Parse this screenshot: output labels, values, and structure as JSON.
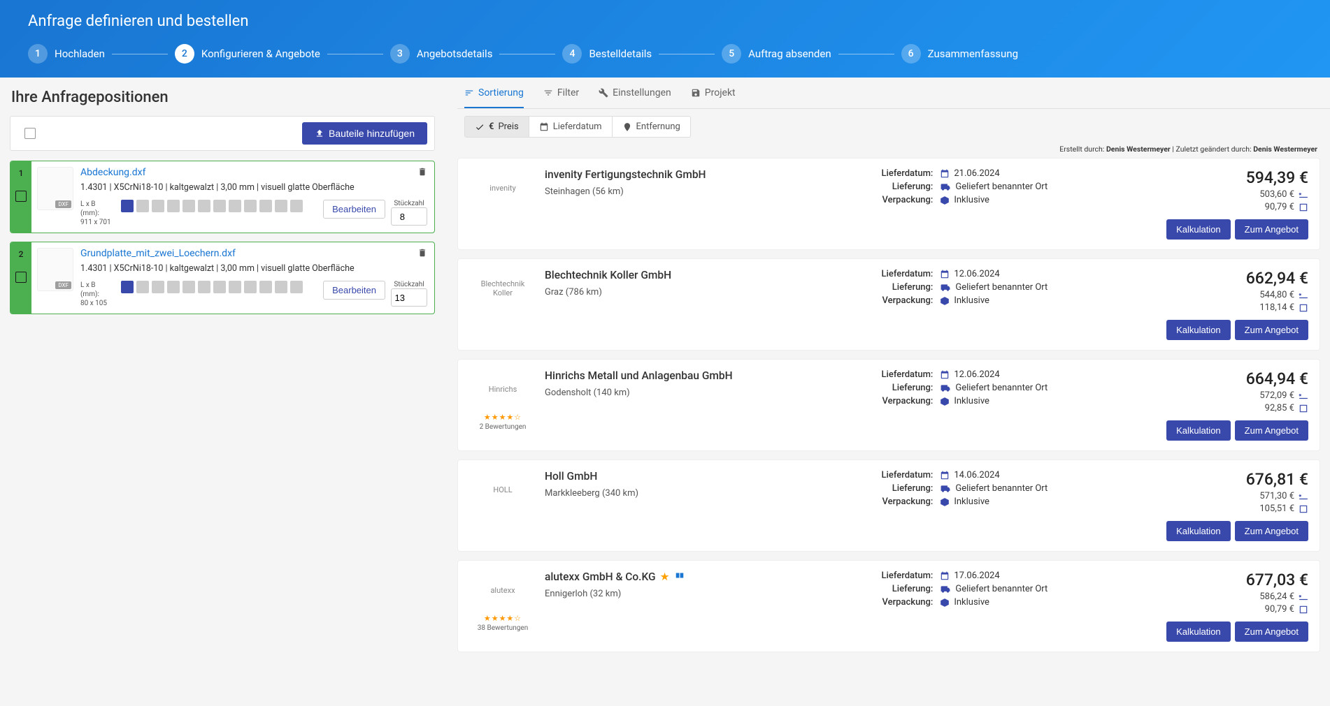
{
  "header": {
    "title": "Anfrage definieren und bestellen",
    "steps": [
      {
        "num": "1",
        "label": "Hochladen"
      },
      {
        "num": "2",
        "label": "Konfigurieren & Angebote"
      },
      {
        "num": "3",
        "label": "Angebotsdetails"
      },
      {
        "num": "4",
        "label": "Bestelldetails"
      },
      {
        "num": "5",
        "label": "Auftrag absenden"
      },
      {
        "num": "6",
        "label": "Zusammenfassung"
      }
    ]
  },
  "left": {
    "title": "Ihre Anfragepositionen",
    "add_button": "Bauteile hinzufügen",
    "dim_label": "L x B (mm):",
    "qty_label": "Stückzahl",
    "edit_label": "Bearbeiten",
    "thumb_badge": "DXF",
    "parts": [
      {
        "idx": "1",
        "name": "Abdeckung.dxf",
        "spec": "1.4301 | X5CrNi18-10 | kaltgewalzt | 3,00 mm | visuell glatte Oberfläche",
        "dim": "911 x 701",
        "qty": "8"
      },
      {
        "idx": "2",
        "name": "Grundplatte_mit_zwei_Loechern.dxf",
        "spec": "1.4301 | X5CrNi18-10 | kaltgewalzt | 3,00 mm | visuell glatte Oberfläche",
        "dim": "80 x 105",
        "qty": "13"
      }
    ]
  },
  "right": {
    "tabs": [
      {
        "icon": "sort",
        "label": "Sortierung"
      },
      {
        "icon": "filter",
        "label": "Filter"
      },
      {
        "icon": "settings",
        "label": "Einstellungen"
      },
      {
        "icon": "project",
        "label": "Projekt"
      }
    ],
    "sort_chips": [
      {
        "label": "Preis",
        "icon": "euro"
      },
      {
        "label": "Lieferdatum",
        "icon": "calendar"
      },
      {
        "label": "Entfernung",
        "icon": "distance"
      }
    ],
    "meta": {
      "created_label": "Erstellt durch:",
      "created_user": "Denis Westermeyer",
      "sep": " | ",
      "changed_label": "Zuletzt geändert durch:",
      "changed_user": "Denis Westermeyer"
    },
    "common": {
      "date_label": "Lieferdatum:",
      "delivery_label": "Lieferung:",
      "packaging_label": "Verpackung:",
      "kalk_btn": "Kalkulation",
      "angebot_btn": "Zum Angebot"
    },
    "offers": [
      {
        "logo": "invenity",
        "name": "invenity Fertigungstechnik GmbH",
        "loc": "Steinhagen (56 km)",
        "date": "21.06.2024",
        "delivery": "Geliefert benannter Ort",
        "packaging": "Inklusive",
        "price": "594,39 €",
        "sub1": "503,60 €",
        "sub2": "90,79 €",
        "rating": "",
        "rcount": ""
      },
      {
        "logo": "Blechtechnik Koller",
        "name": "Blechtechnik Koller GmbH",
        "loc": "Graz (786 km)",
        "date": "12.06.2024",
        "delivery": "Geliefert benannter Ort",
        "packaging": "Inklusive",
        "price": "662,94 €",
        "sub1": "544,80 €",
        "sub2": "118,14 €",
        "rating": "",
        "rcount": ""
      },
      {
        "logo": "Hinrichs",
        "name": "Hinrichs Metall und Anlagenbau GmbH",
        "loc": "Godensholt (140 km)",
        "date": "12.06.2024",
        "delivery": "Geliefert benannter Ort",
        "packaging": "Inklusive",
        "price": "664,94 €",
        "sub1": "572,09 €",
        "sub2": "92,85 €",
        "rating": "★★★★☆",
        "rcount": "2 Bewertungen"
      },
      {
        "logo": "HOLL",
        "name": "Holl GmbH",
        "loc": "Markkleeberg (340 km)",
        "date": "14.06.2024",
        "delivery": "Geliefert benannter Ort",
        "packaging": "Inklusive",
        "price": "676,81 €",
        "sub1": "571,30 €",
        "sub2": "105,51 €",
        "rating": "",
        "rcount": ""
      },
      {
        "logo": "alutexx",
        "name": "alutexx GmbH & Co.KG",
        "loc": "Ennigerloh (32 km)",
        "date": "17.06.2024",
        "delivery": "Geliefert benannter Ort",
        "packaging": "Inklusive",
        "price": "677,03 €",
        "sub1": "586,24 €",
        "sub2": "90,79 €",
        "rating": "★★★★☆",
        "rcount": "38 Bewertungen",
        "badges": true
      }
    ]
  }
}
